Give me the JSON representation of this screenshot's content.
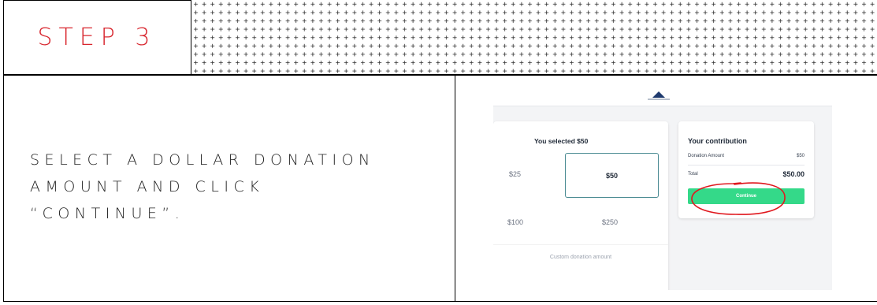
{
  "step": {
    "title": "STEP 3"
  },
  "instruction": {
    "lines": [
      "SELECT A DOLLAR DONATION",
      "AMOUNT AND CLICK",
      "“CONTINUE”."
    ]
  },
  "donation": {
    "selected_title": "You selected $50",
    "amounts": [
      "$25",
      "$50",
      "$100",
      "$250"
    ],
    "custom_label": "Custom donation amount"
  },
  "contribution": {
    "title": "Your contribution",
    "donation_label": "Donation Amount",
    "donation_value": "$50",
    "total_label": "Total",
    "total_value": "$50.00",
    "continue_label": "Continue"
  },
  "colors": {
    "step_red": "#d8262e",
    "continue_green": "#34d989",
    "selected_border": "#4b8b93",
    "annotation_red": "#e0181e",
    "logo_navy": "#1e3a6e"
  }
}
